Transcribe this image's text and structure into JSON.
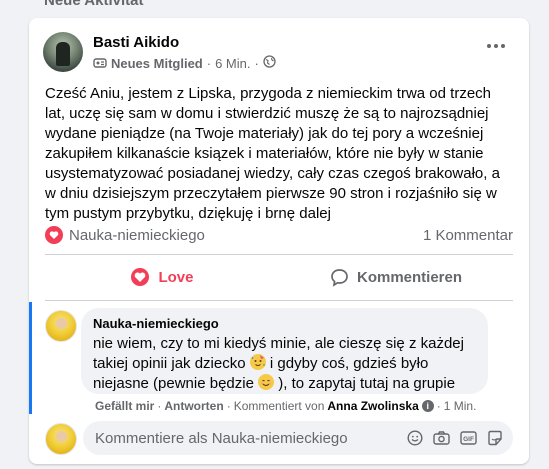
{
  "section": {
    "title": "Neue Aktivität"
  },
  "post": {
    "author": "Basti Aikido",
    "badge": "Neues Mitglied",
    "time": "6 Min.",
    "separator": "·",
    "lines": [
      "Cześć Aniu, jestem z Lipska, przygoda z niemieckim trwa od trzech",
      "lat, uczę się sam w domu i stwierdzić muszę że są to najrozsądniej",
      "wydane pieniądze (na Twoje materiały) jak do tej pory a wcześniej",
      "zakupiłem kilkanaście ksiązek i materiałów, które nie były w stanie",
      "usystematyzować posiadanej wiedzy, cały czas czegoś brakowało, a",
      "w dniu dzisiejszym przeczytałem pierwsze 90 stron i rozjaśniło się w",
      "tym pustym przybytku, dziękuję i brnę dalej"
    ],
    "reaction_name": "Nauka-niemieckiego",
    "comment_count": "1 Kommentar"
  },
  "actions": {
    "love_label": "Love",
    "comment_label": "Kommentieren"
  },
  "comment": {
    "author": "Nauka-niemieckiego",
    "line1": "nie wiem, czy to mi kiedyś minie, ale cieszę się z każdej",
    "line2_a": "takiej opinii jak dziecko ",
    "line2_b": " i gdyby coś, gdzieś było",
    "line3_a": "niejasne (pewnie będzie ",
    "line3_b": " ), to zapytaj tutaj na grupie",
    "like_label": "Gefällt mir",
    "reply_label": "Antworten",
    "commented_by": "Kommentiert von",
    "commented_by_name": "Anna Zwolinska",
    "time": "1 Min.",
    "separator": "·"
  },
  "reply": {
    "placeholder": "Kommentiere als Nauka-niemieckiego"
  },
  "icons": [
    "globe-icon",
    "more-icon",
    "heart-icon",
    "comment-icon",
    "info-icon",
    "smiley-icon",
    "camera-icon",
    "gif-icon",
    "sticker-icon"
  ],
  "colors": {
    "love": "#f33e58",
    "accent": "#1877f2",
    "muted": "#65676b"
  }
}
